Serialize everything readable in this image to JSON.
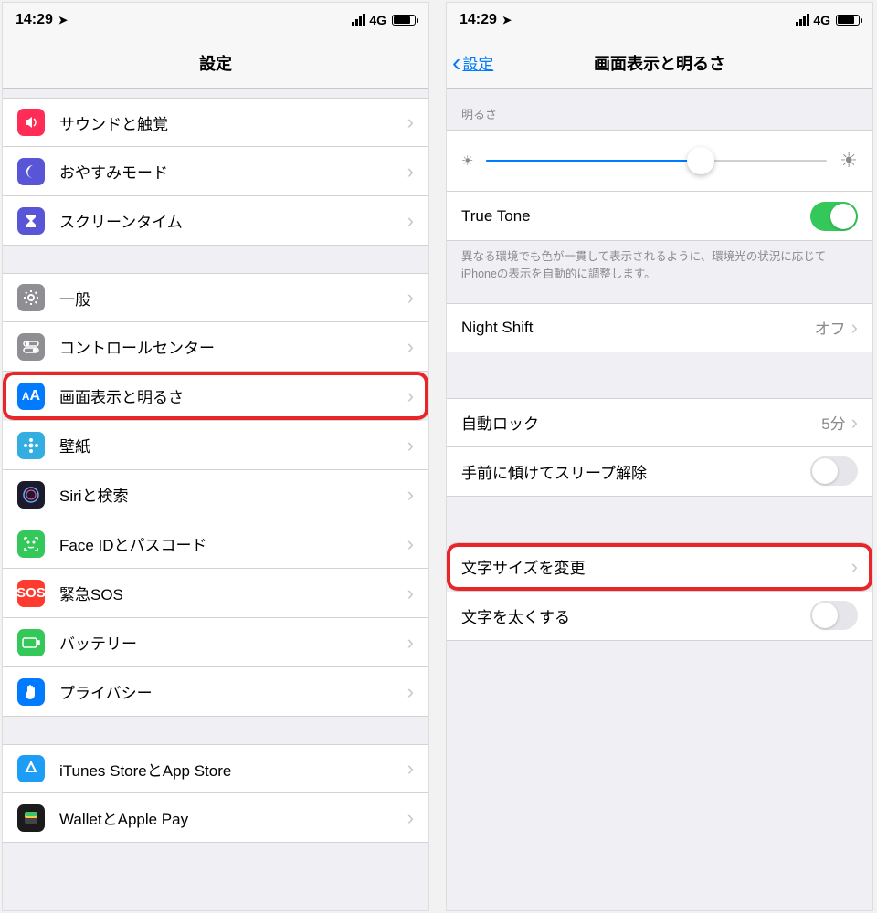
{
  "status": {
    "time": "14:29",
    "network": "4G"
  },
  "left": {
    "title": "設定",
    "items": [
      {
        "id": "sound",
        "label": "サウンドと触覚",
        "icon": "speaker"
      },
      {
        "id": "dnd",
        "label": "おやすみモード",
        "icon": "moon"
      },
      {
        "id": "screentime",
        "label": "スクリーンタイム",
        "icon": "hourglass"
      }
    ],
    "items2": [
      {
        "id": "general",
        "label": "一般",
        "icon": "gear"
      },
      {
        "id": "controlcenter",
        "label": "コントロールセンター",
        "icon": "switches"
      },
      {
        "id": "display",
        "label": "画面表示と明るさ",
        "icon": "AA",
        "highlight": true
      },
      {
        "id": "wallpaper",
        "label": "壁紙",
        "icon": "flower"
      },
      {
        "id": "siri",
        "label": "Siriと検索",
        "icon": "siri"
      },
      {
        "id": "faceid",
        "label": "Face IDとパスコード",
        "icon": "faceid"
      },
      {
        "id": "sos",
        "label": "緊急SOS",
        "icon": "SOS"
      },
      {
        "id": "battery",
        "label": "バッテリー",
        "icon": "battery"
      },
      {
        "id": "privacy",
        "label": "プライバシー",
        "icon": "hand"
      }
    ],
    "items3": [
      {
        "id": "appstore",
        "label": "iTunes StoreとApp Store",
        "icon": "A"
      },
      {
        "id": "wallet",
        "label": "WalletとApple Pay",
        "icon": "wallet"
      }
    ]
  },
  "right": {
    "back": "設定",
    "title": "画面表示と明るさ",
    "brightness_label": "明るさ",
    "brightness_value": 63,
    "truetone_label": "True Tone",
    "truetone_on": true,
    "truetone_footer": "異なる環境でも色が一貫して表示されるように、環境光の状況に応じてiPhoneの表示を自動的に調整します。",
    "nightshift_label": "Night Shift",
    "nightshift_value": "オフ",
    "autolock_label": "自動ロック",
    "autolock_value": "5分",
    "raise_label": "手前に傾けてスリープ解除",
    "raise_on": false,
    "textsize_label": "文字サイズを変更",
    "textsize_highlight": true,
    "boldtext_label": "文字を太くする",
    "boldtext_on": false
  }
}
